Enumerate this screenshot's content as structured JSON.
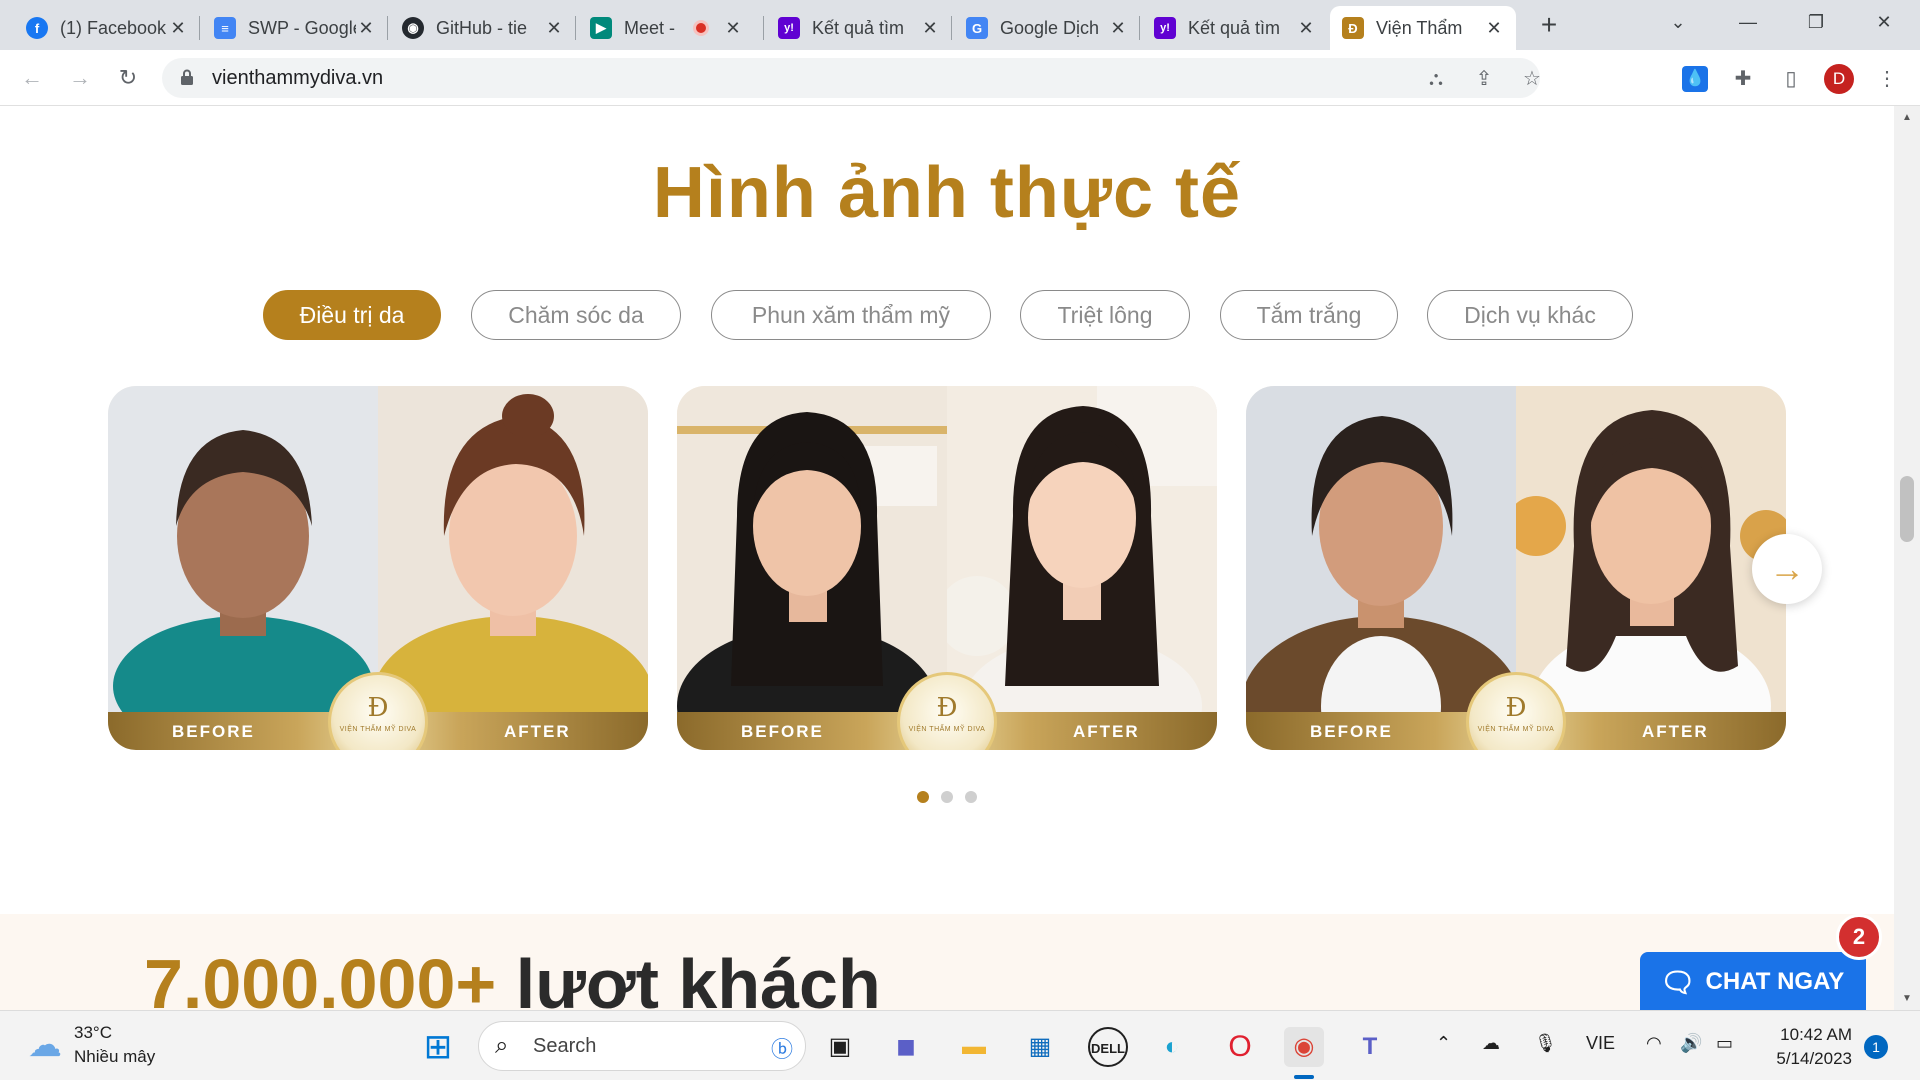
{
  "browser": {
    "tabs": [
      {
        "label": "(1) Facebook",
        "icon": "facebook-icon",
        "color": "#1877f2",
        "glyph": "f"
      },
      {
        "label": "SWP - Google",
        "icon": "google-docs-icon",
        "color": "#4285f4",
        "glyph": "≡"
      },
      {
        "label": "GitHub - tie",
        "icon": "github-icon",
        "color": "#24292f",
        "glyph": "◉"
      },
      {
        "label": "Meet -",
        "icon": "google-meet-icon",
        "color": "#00897b",
        "glyph": "▶"
      },
      {
        "label": "Kết quả tìm",
        "icon": "yahoo-icon",
        "color": "#6001d2",
        "glyph": "y!"
      },
      {
        "label": "Google Dịch",
        "icon": "google-translate-icon",
        "color": "#4285f4",
        "glyph": "G"
      },
      {
        "label": "Kết quả tìm",
        "icon": "yahoo-icon",
        "color": "#6001d2",
        "glyph": "y!"
      },
      {
        "label": "Viện Thẩm",
        "icon": "diva-icon",
        "color": "#b5801d",
        "glyph": "Ð"
      }
    ],
    "address": "vienthammydiva.vn",
    "profile_initial": "D"
  },
  "page": {
    "title": "Hình ảnh thực tế",
    "categories": [
      "Điều trị da",
      "Chăm sóc da",
      "Phun xăm thẩm mỹ",
      "Triệt lông",
      "Tắm trắng",
      "Dịch vụ khác"
    ],
    "active_category": 0,
    "cards": [
      {
        "before": "BEFORE",
        "after": "AFTER",
        "seal_text": "VIỆN THẨM MỸ DIVA"
      },
      {
        "before": "BEFORE",
        "after": "AFTER",
        "seal_text": "VIỆN THẨM MỸ DIVA"
      },
      {
        "before": "BEFORE",
        "after": "AFTER",
        "seal_text": "VIỆN THẨM MỸ DIVA"
      }
    ],
    "carousel_pages": 3,
    "carousel_current": 0,
    "stats_heading_number": "7.000.000+",
    "stats_heading_text": "lượt khách",
    "chat_label": "CHAT NGAY",
    "chat_badge": "2"
  },
  "taskbar": {
    "weather_temp": "33°C",
    "weather_desc": "Nhiều mây",
    "search_label": "Search",
    "language": "VIE",
    "time": "10:42 AM",
    "date": "5/14/2023",
    "notifications": "1"
  },
  "colors": {
    "accent_gold": "#b5801d",
    "chat_blue": "#1a73e8",
    "badge_red": "#d32f2f"
  }
}
